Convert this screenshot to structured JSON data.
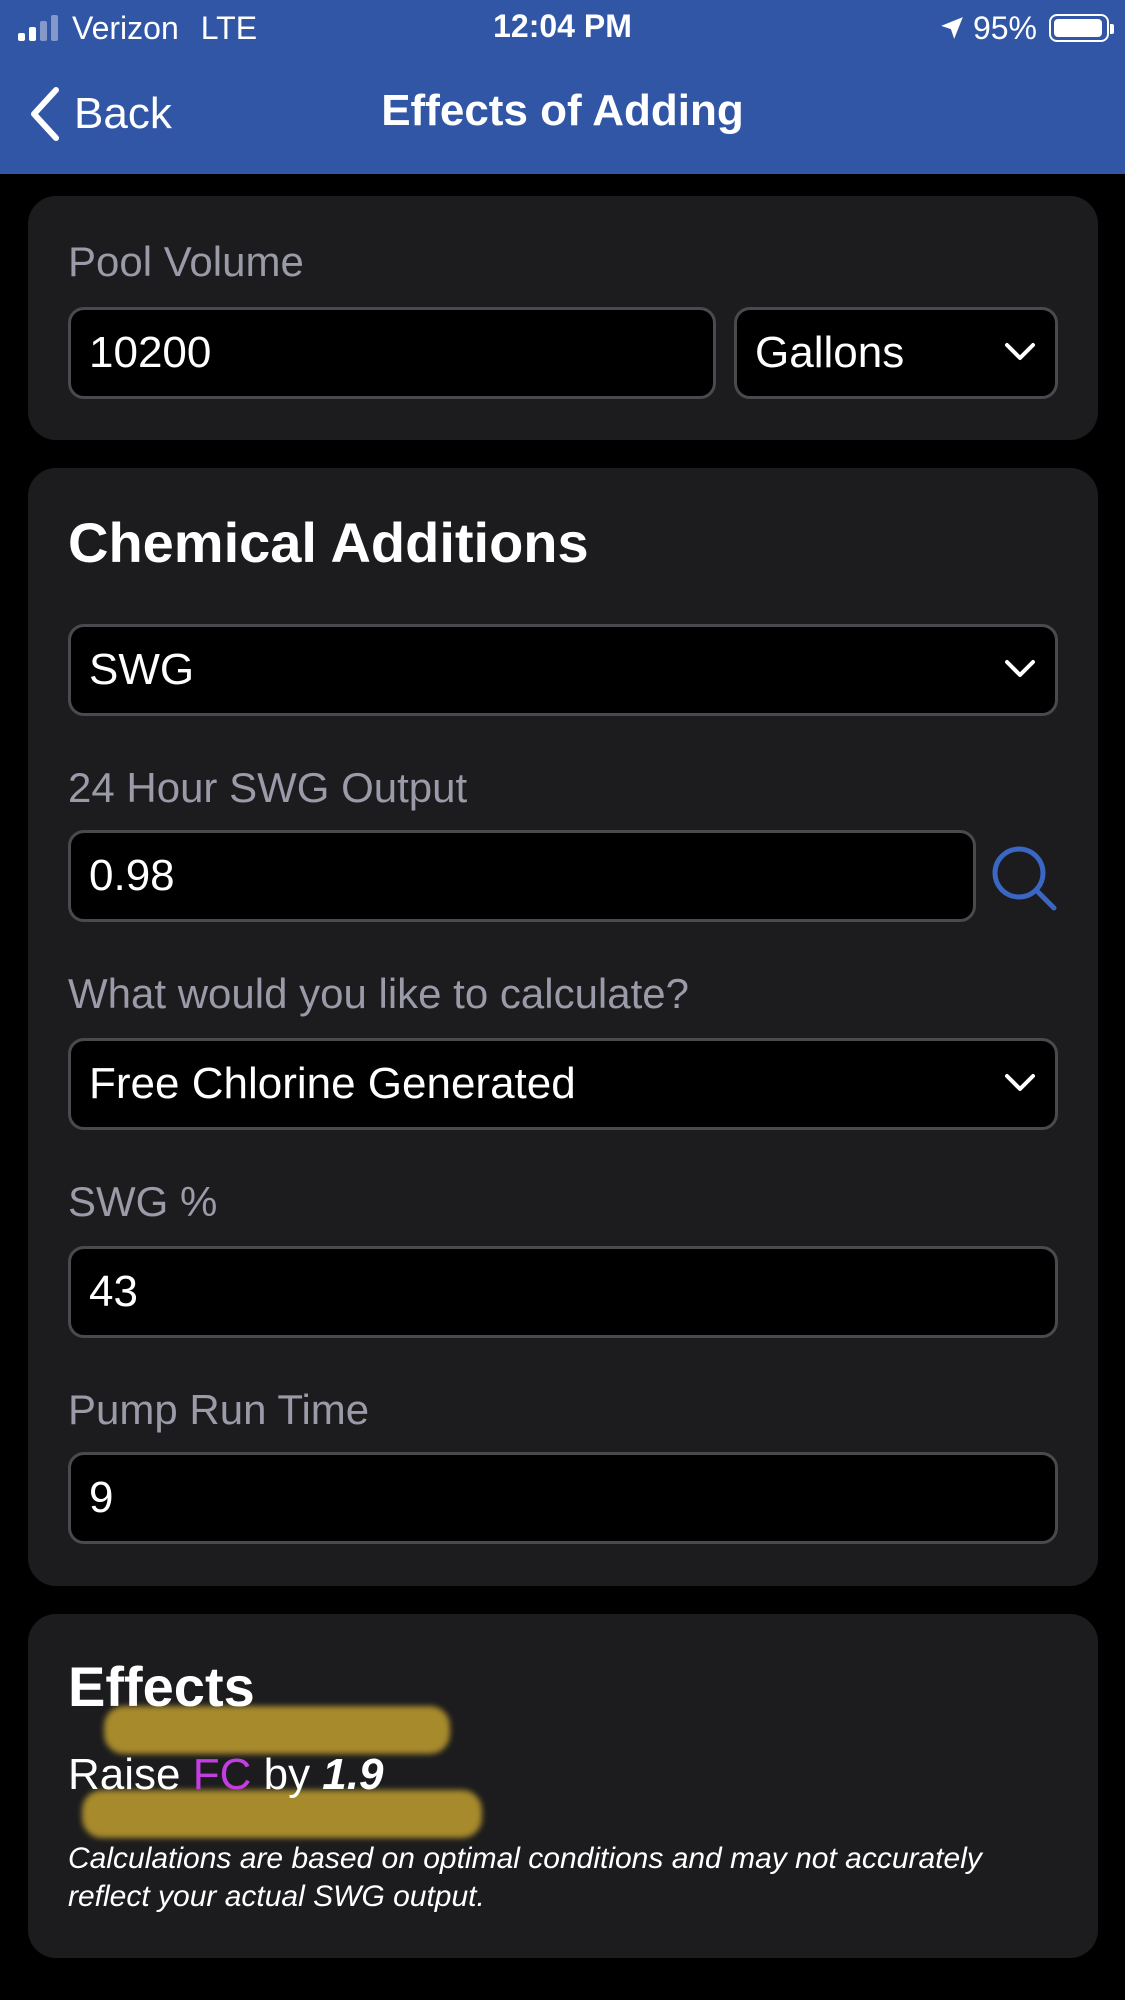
{
  "status_bar": {
    "carrier": "Verizon",
    "network": "LTE",
    "time": "12:04 PM",
    "battery": "95%",
    "battery_level": 0.95,
    "signal_bars": 2
  },
  "nav": {
    "back_label": "Back",
    "title": "Effects of Adding"
  },
  "pool": {
    "volume_label": "Pool Volume",
    "volume_value": "10200",
    "unit_value": "Gallons"
  },
  "chemical": {
    "title": "Chemical Additions",
    "chemical_value": "SWG",
    "output_label": "24 Hour SWG Output",
    "output_value": "0.98",
    "calculate_label": "What would you like to calculate?",
    "calculate_value": "Free Chlorine Generated",
    "swg_percent_label": "SWG %",
    "swg_percent_value": "43",
    "pump_label": "Pump Run Time",
    "pump_value": "9"
  },
  "effects": {
    "title": "Effects",
    "raise_prefix": "Raise ",
    "raise_chemical": "FC",
    "raise_by": " by ",
    "raise_amount": "1.9",
    "note": "Calculations are based on optimal conditions and may not accurately reflect your actual SWG output."
  },
  "colors": {
    "header": "#3256a6",
    "card": "#1c1c1e",
    "accent_fc": "#c33ee0",
    "search_icon": "#3a66c4",
    "highlight": "#d6af32"
  }
}
